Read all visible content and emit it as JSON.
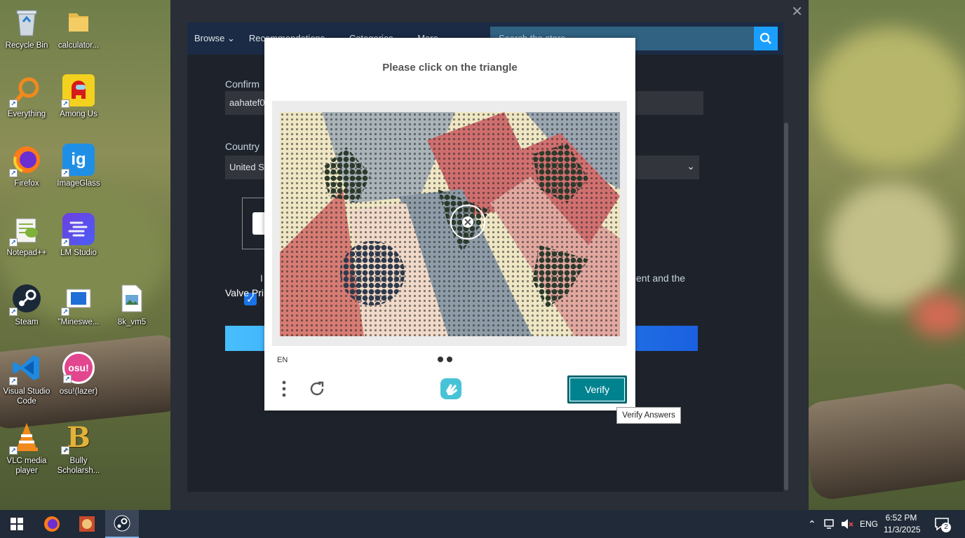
{
  "desktop": {
    "icons": [
      {
        "label": "Recycle Bin",
        "icon": "recycle-bin-icon"
      },
      {
        "label": "calculator...",
        "icon": "folder-icon"
      },
      {
        "label": "Everything",
        "icon": "magnifier-icon"
      },
      {
        "label": "Among Us",
        "icon": "among-us-icon"
      },
      {
        "label": "Firefox",
        "icon": "firefox-icon"
      },
      {
        "label": "ImageGlass",
        "icon": "imageglass-icon",
        "glyph": "ig"
      },
      {
        "label": "Notepad++",
        "icon": "notepad-plus-plus-icon"
      },
      {
        "label": "LM Studio",
        "icon": "lm-studio-icon"
      },
      {
        "label": "Steam",
        "icon": "steam-icon"
      },
      {
        "label": "\"Mineswe...",
        "icon": "minesweeper-icon"
      },
      {
        "label": "8k_vm5",
        "icon": "image-file-icon"
      },
      {
        "label": "Visual Studio Code",
        "icon": "vscode-icon"
      },
      {
        "label": "osu!(lazer)",
        "icon": "osu-icon",
        "glyph": "osu!"
      },
      {
        "label": "VLC media player",
        "icon": "vlc-icon"
      },
      {
        "label": "Bully Scholarsh...",
        "icon": "bully-icon",
        "glyph": "B"
      }
    ]
  },
  "steam": {
    "nav": {
      "browse": "Browse",
      "recommendations": "Recommendations",
      "categories": "Categories",
      "more": "More",
      "search_placeholder": "Search the store"
    },
    "form": {
      "confirm_label": "Confirm",
      "confirm_value": "aahatef0",
      "country_label": "Country",
      "country_value": "United S",
      "agree_text_start": "I am",
      "agree_text_end": "ent and the",
      "privacy_text": "Valve Pri"
    }
  },
  "captcha": {
    "prompt": "Please click on the triangle",
    "language": "EN",
    "verify_label": "Verify",
    "tooltip": "Verify Answers",
    "colors": {
      "verify": "#00838f",
      "accent": "#1a9fff"
    }
  },
  "taskbar": {
    "language": "ENG",
    "time": "6:52 PM",
    "date": "11/3/2025",
    "notification_count": "2"
  }
}
